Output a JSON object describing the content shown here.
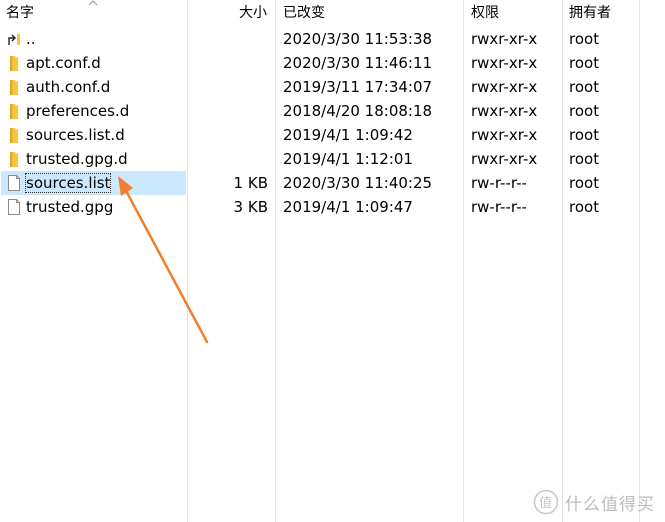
{
  "columns": {
    "name": "名字",
    "size": "大小",
    "modified": "已改变",
    "permissions": "权限",
    "owner": "拥有者"
  },
  "rows": [
    {
      "icon": "parent-folder-icon",
      "name": "..",
      "size": "",
      "modified": "2020/3/30 11:53:38",
      "permissions": "rwxr-xr-x",
      "owner": "root"
    },
    {
      "icon": "folder-icon",
      "name": "apt.conf.d",
      "size": "",
      "modified": "2020/3/30 11:46:11",
      "permissions": "rwxr-xr-x",
      "owner": "root"
    },
    {
      "icon": "folder-icon",
      "name": "auth.conf.d",
      "size": "",
      "modified": "2019/3/11 17:34:07",
      "permissions": "rwxr-xr-x",
      "owner": "root"
    },
    {
      "icon": "folder-icon",
      "name": "preferences.d",
      "size": "",
      "modified": "2018/4/20 18:08:18",
      "permissions": "rwxr-xr-x",
      "owner": "root"
    },
    {
      "icon": "folder-icon",
      "name": "sources.list.d",
      "size": "",
      "modified": "2019/4/1 1:09:42",
      "permissions": "rwxr-xr-x",
      "owner": "root"
    },
    {
      "icon": "folder-icon",
      "name": "trusted.gpg.d",
      "size": "",
      "modified": "2019/4/1 1:12:01",
      "permissions": "rwxr-xr-x",
      "owner": "root"
    },
    {
      "icon": "file-icon",
      "name": "sources.list",
      "size": "1 KB",
      "modified": "2020/3/30 11:40:25",
      "permissions": "rw-r--r--",
      "owner": "root",
      "selected": true
    },
    {
      "icon": "file-icon",
      "name": "trusted.gpg",
      "size": "3 KB",
      "modified": "2019/4/1 1:09:47",
      "permissions": "rw-r--r--",
      "owner": "root"
    }
  ],
  "colors": {
    "selection": "#cce8ff",
    "folder": "#f5c543",
    "arrow": "#f07f2d"
  },
  "watermark": {
    "logo_char": "值",
    "text": "什么值得买"
  }
}
